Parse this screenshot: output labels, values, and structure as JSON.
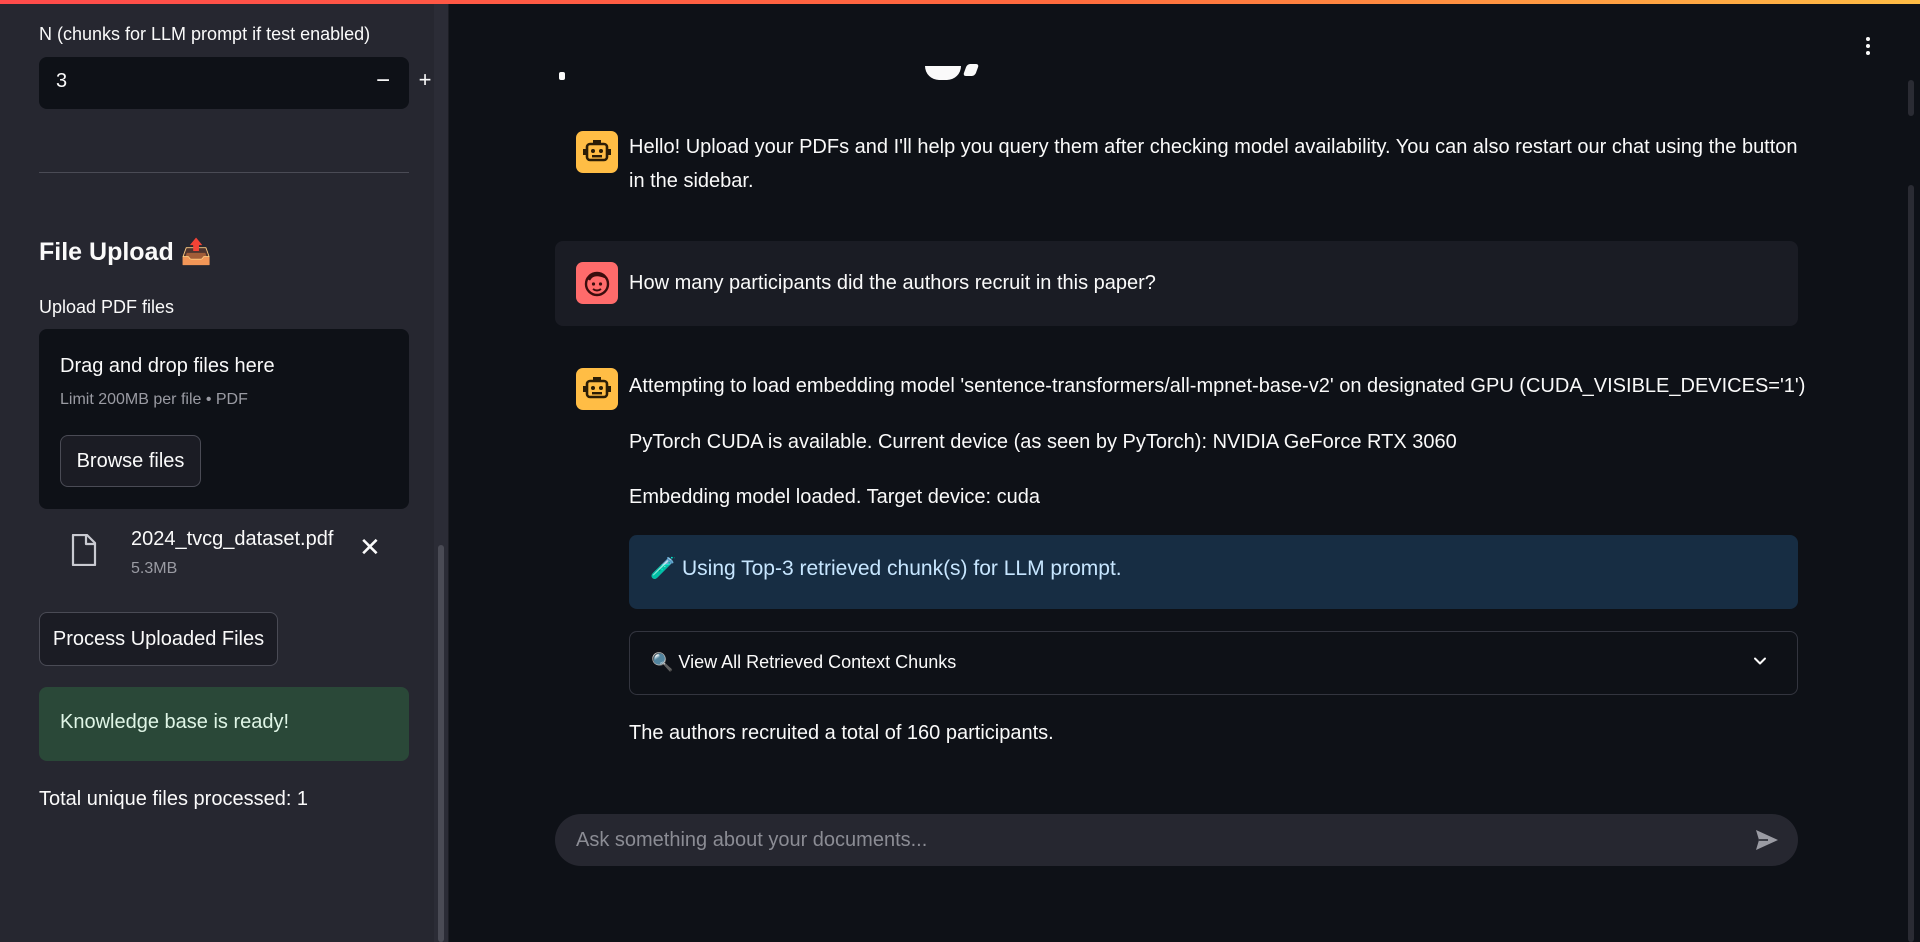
{
  "sidebar": {
    "n_label": "N (chunks for LLM prompt if test enabled)",
    "n_value": "3",
    "minus_label": "−",
    "plus_label": "+",
    "upload_heading": "File Upload 📤",
    "upload_label": "Upload PDF files",
    "dropzone_title": "Drag and drop files here",
    "dropzone_limit": "Limit 200MB per file • PDF",
    "browse_label": "Browse files",
    "file": {
      "name": "2024_tvcg_dataset.pdf",
      "size": "5.3MB"
    },
    "close_label": "✕",
    "process_label": "Process Uploaded Files",
    "status_success": "Knowledge base is ready!",
    "total_files": "Total unique files processed: 1"
  },
  "chat": {
    "messages": [
      {
        "role": "assistant",
        "text": "Hello! Upload your PDFs and I'll help you query them after checking model availability. You can also restart our chat using the button in the sidebar."
      },
      {
        "role": "user",
        "text": "How many participants did the authors recruit in this paper?"
      },
      {
        "role": "assistant",
        "lines": [
          "Attempting to load embedding model 'sentence-transformers/all-mpnet-base-v2' on designated GPU (CUDA_VISIBLE_DEVICES='1')",
          "PyTorch CUDA is available. Current device (as seen by PyTorch): NVIDIA GeForce RTX 3060",
          "Embedding model loaded. Target device: cuda"
        ],
        "info": "🧪 Using Top-3 retrieved chunk(s) for LLM prompt.",
        "expander": "🔍 View All Retrieved Context Chunks",
        "answer": "The authors recruited a total of 160 participants."
      }
    ],
    "input_placeholder": "Ask something about your documents..."
  },
  "colors": {
    "background": "#0e1117",
    "sidebar": "#262730",
    "bot_avatar": "#ffbd45",
    "user_avatar": "#ff6b6b",
    "success_bg": "#2a4838",
    "info_bg": "#172d43"
  },
  "icons": {
    "bot": "robot-icon",
    "user": "face-icon",
    "file": "file-icon",
    "chevron": "chevron-down-icon",
    "send": "send-icon",
    "menu": "kebab-menu-icon"
  }
}
